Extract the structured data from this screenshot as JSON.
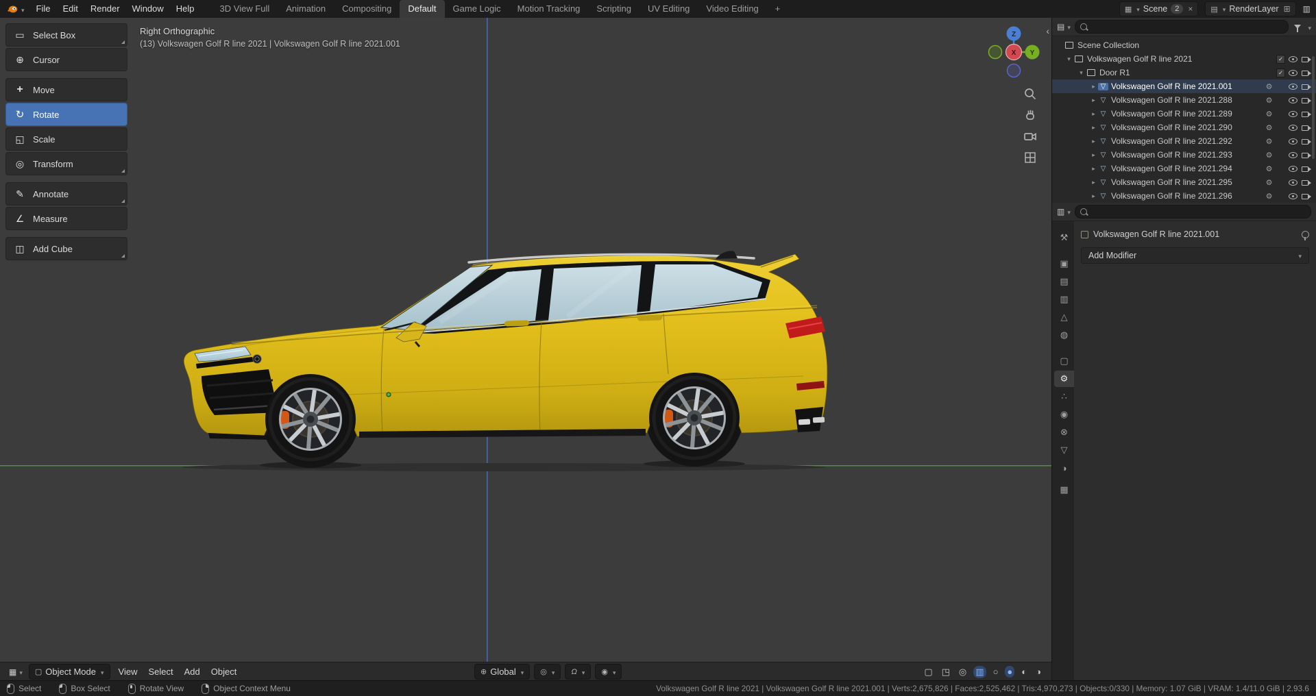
{
  "colors": {
    "accent": "#4772b3",
    "car-yellow": "#e3c01c",
    "glass": "#b9cfd9",
    "axis-green": "#4e8c3e",
    "axis-blue": "#4a67aa",
    "caliper-orange": "#d25816",
    "tail-red": "#c11b1b"
  },
  "glyphs": {
    "collapse": "‹"
  },
  "topbar": {
    "menus": [
      "File",
      "Edit",
      "Render",
      "Window",
      "Help"
    ],
    "tabs": [
      {
        "label": "3D View Full"
      },
      {
        "label": "Animation"
      },
      {
        "label": "Compositing"
      },
      {
        "label": "Default",
        "state": "active"
      },
      {
        "label": "Game Logic"
      },
      {
        "label": "Motion Tracking"
      },
      {
        "label": "Scripting"
      },
      {
        "label": "UV Editing"
      },
      {
        "label": "Video Editing"
      },
      {
        "label": "+"
      }
    ],
    "scene_selector": {
      "glyph": "▦",
      "label": "Scene",
      "count": "2",
      "unlink": "×"
    },
    "layer_selector": {
      "glyph": "▤",
      "label": "RenderLayer",
      "new": "⊞"
    },
    "window_glyph": "▥"
  },
  "toolshelf": {
    "tools": [
      {
        "label": "Select Box",
        "icon": "ti-select",
        "gap": 0,
        "corner": true
      },
      {
        "label": "Cursor",
        "icon": "ti-cursor",
        "gap": 2
      },
      {
        "label": "Move",
        "icon": "ti-move",
        "gap": 10
      },
      {
        "label": "Rotate",
        "icon": "ti-rotate",
        "gap": 2,
        "state": "active"
      },
      {
        "label": "Scale",
        "icon": "ti-scale",
        "gap": 2
      },
      {
        "label": "Transform",
        "icon": "ti-transform",
        "gap": 2,
        "corner": true
      },
      {
        "label": "Annotate",
        "icon": "ti-annotate",
        "gap": 10,
        "corner": true
      },
      {
        "label": "Measure",
        "icon": "ti-measure",
        "gap": 2
      },
      {
        "label": "Add Cube",
        "icon": "ti-cube",
        "gap": 10,
        "corner": true
      }
    ]
  },
  "viewport": {
    "view_label": "Right Orthographic",
    "object_label": "(13) Volkswagen Golf R line 2021 | Volkswagen Golf R line 2021.001",
    "gizmo": {
      "x": "X",
      "y": "Y",
      "z": "Z"
    },
    "header": {
      "editor_glyph": "▦",
      "mode_glyph": "▢",
      "mode": "Object Mode",
      "menus": [
        "View",
        "Select",
        "Add",
        "Object"
      ],
      "controls": [
        {
          "name": "transform-orientation",
          "glyph": "⊕",
          "label": "Global"
        },
        {
          "name": "transform-pivot",
          "glyph": "◎",
          "label": ""
        },
        {
          "name": "snapping-magnet",
          "glyph": "Ω",
          "label": ""
        },
        {
          "name": "proportional-editing",
          "glyph": "◉",
          "label": ""
        }
      ],
      "right_icons": [
        {
          "name": "selectability-toggle",
          "glyph": "▢"
        },
        {
          "name": "gizmo-toggle",
          "glyph": "◳"
        },
        {
          "name": "overlays-toggle",
          "glyph": "◎"
        },
        {
          "name": "xray-toggle",
          "glyph": "▥",
          "state": "on"
        },
        {
          "name": "shading-wireframe",
          "glyph": "○"
        },
        {
          "name": "shading-solid",
          "glyph": "●",
          "state": "on"
        },
        {
          "name": "shading-material",
          "glyph": "◐"
        },
        {
          "name": "shading-rendered",
          "glyph": "◑"
        }
      ]
    }
  },
  "outliner": {
    "editor_glyph": "▤",
    "rows": [
      {
        "label": "Scene Collection",
        "icon": "oi-scene",
        "caret": "",
        "indent": 4
      },
      {
        "label": "Volkswagen Golf R line 2021",
        "icon": "oi-coll",
        "caret": "▾",
        "indent": 18,
        "check": true,
        "eye": true,
        "cam": true
      },
      {
        "label": "Door R1",
        "icon": "oi-coll",
        "caret": "▾",
        "indent": 36,
        "check": true,
        "eye": true,
        "cam": true
      },
      {
        "label": "Volkswagen Golf R line 2021.001",
        "icon": "oi-mesh",
        "caret": "▸",
        "indent": 54,
        "wrench": true,
        "eye": true,
        "cam": true,
        "state": "active"
      },
      {
        "label": "Volkswagen Golf R line 2021.288",
        "icon": "oi-mesh",
        "caret": "▸",
        "indent": 54,
        "wrench": true,
        "eye": true,
        "cam": true
      },
      {
        "label": "Volkswagen Golf R line 2021.289",
        "icon": "oi-mesh",
        "caret": "▸",
        "indent": 54,
        "wrench": true,
        "eye": true,
        "cam": true
      },
      {
        "label": "Volkswagen Golf R line 2021.290",
        "icon": "oi-mesh",
        "caret": "▸",
        "indent": 54,
        "wrench": true,
        "eye": true,
        "cam": true
      },
      {
        "label": "Volkswagen Golf R line 2021.292",
        "icon": "oi-mesh",
        "caret": "▸",
        "indent": 54,
        "wrench": true,
        "eye": true,
        "cam": true
      },
      {
        "label": "Volkswagen Golf R line 2021.293",
        "icon": "oi-mesh",
        "caret": "▸",
        "indent": 54,
        "wrench": true,
        "eye": true,
        "cam": true
      },
      {
        "label": "Volkswagen Golf R line 2021.294",
        "icon": "oi-mesh",
        "caret": "▸",
        "indent": 54,
        "wrench": true,
        "eye": true,
        "cam": true
      },
      {
        "label": "Volkswagen Golf R line 2021.295",
        "icon": "oi-mesh",
        "caret": "▸",
        "indent": 54,
        "wrench": true,
        "eye": true,
        "cam": true
      },
      {
        "label": "Volkswagen Golf R line 2021.296",
        "icon": "oi-mesh",
        "caret": "▸",
        "indent": 54,
        "wrench": true,
        "eye": true,
        "cam": true
      }
    ]
  },
  "properties": {
    "editor_glyph": "▥",
    "breadcrumb": "Volkswagen Golf R line 2021.001",
    "add_modifier_label": "Add Modifier",
    "tabs": [
      {
        "name": "tool",
        "glyph": "⚒",
        "gap": 0
      },
      {
        "name": "render",
        "glyph": "▣",
        "gap": 14
      },
      {
        "name": "output",
        "glyph": "▤",
        "gap": 2
      },
      {
        "name": "view-layer",
        "glyph": "▥",
        "gap": 2
      },
      {
        "name": "scene",
        "glyph": "△",
        "gap": 2
      },
      {
        "name": "world",
        "glyph": "◍",
        "gap": 2
      },
      {
        "name": "object",
        "glyph": "▢",
        "cls": "c-object",
        "gap": 14
      },
      {
        "name": "modifiers",
        "glyph": "⚙",
        "gap": 2,
        "state": "active"
      },
      {
        "name": "particles",
        "glyph": "∴",
        "gap": 2
      },
      {
        "name": "physics",
        "glyph": "◉",
        "gap": 2
      },
      {
        "name": "constraints",
        "glyph": "⊗",
        "gap": 2
      },
      {
        "name": "data",
        "glyph": "▽",
        "cls": "c-data",
        "gap": 2
      },
      {
        "name": "material",
        "glyph": "◑",
        "cls": "c-material",
        "gap": 2
      },
      {
        "name": "texture",
        "glyph": "▦",
        "gap": 8
      }
    ]
  },
  "statusbar": {
    "hints": [
      {
        "label": "Select",
        "mouse": "m-left"
      },
      {
        "label": "Box Select",
        "mouse": "m-left"
      },
      {
        "label": "Rotate View",
        "mouse": "m-mid"
      },
      {
        "label": "Object Context Menu",
        "mouse": "m-right"
      }
    ],
    "stats": "Volkswagen Golf R line 2021 | Volkswagen Golf R line 2021.001 | Verts:2,675,826 | Faces:2,525,462 | Tris:4,970,273 | Objects:0/330 | Memory: 1.07 GiB | VRAM: 1.4/11.0 GiB | 2.93.6"
  }
}
